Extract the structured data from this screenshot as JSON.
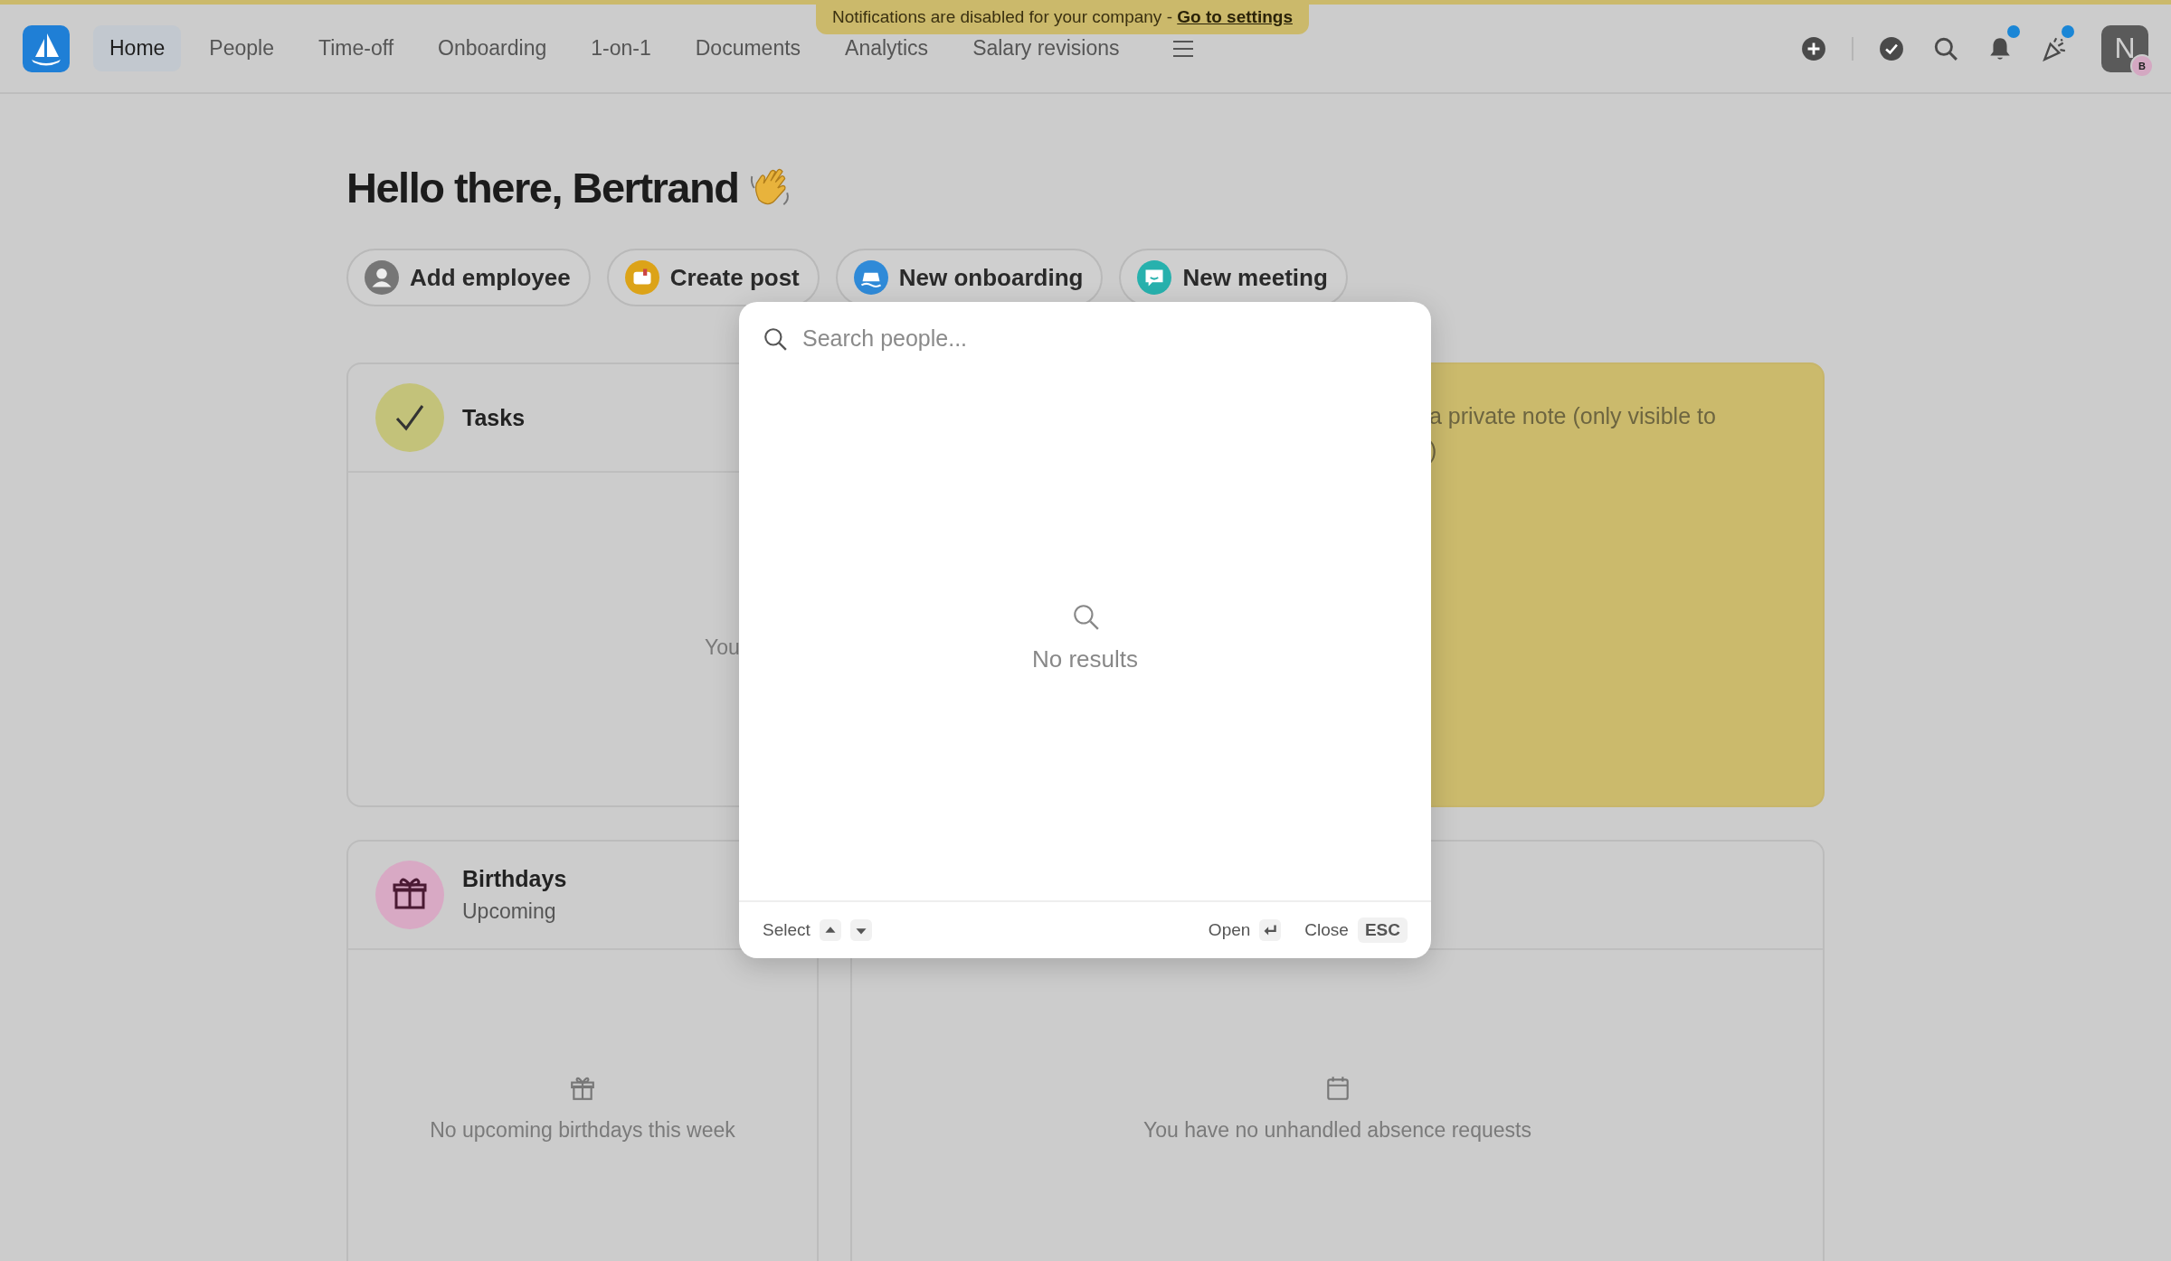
{
  "notification_banner": {
    "text": "Notifications are disabled for your company - ",
    "link": "Go to settings"
  },
  "nav": {
    "items": [
      {
        "label": "Home",
        "selected": true
      },
      {
        "label": "People",
        "selected": false
      },
      {
        "label": "Time-off",
        "selected": false
      },
      {
        "label": "Onboarding",
        "selected": false
      },
      {
        "label": "1-on-1",
        "selected": false
      },
      {
        "label": "Documents",
        "selected": false
      },
      {
        "label": "Analytics",
        "selected": false
      },
      {
        "label": "Salary revisions",
        "selected": false
      }
    ]
  },
  "toolbar": [
    {
      "kind": "add",
      "badge": false
    },
    {
      "kind": "tasks",
      "badge": false
    },
    {
      "kind": "search",
      "badge": false
    },
    {
      "kind": "notifications",
      "badge": true
    },
    {
      "kind": "celebrations",
      "badge": true
    }
  ],
  "avatar": {
    "initial": "N",
    "badge_initial": "B"
  },
  "greeting": "Hello there, Bertrand",
  "quick_actions": [
    {
      "label": "Add employee",
      "kind": "employee"
    },
    {
      "label": "Create post",
      "kind": "post"
    },
    {
      "label": "New onboarding",
      "kind": "onboarding"
    },
    {
      "label": "New meeting",
      "kind": "meeting"
    }
  ],
  "tasks_card": {
    "title": "Tasks",
    "text": "You"
  },
  "note_card": {
    "lines": [
      "a private note (only visible to",
      ")"
    ]
  },
  "birthdays_card": {
    "title": "Birthdays",
    "subtitle": "Upcoming",
    "empty": "No upcoming birthdays this week"
  },
  "absence_card": {
    "empty": "You have no unhandled absence requests"
  },
  "search_modal": {
    "placeholder": "Search people...",
    "empty": "No results",
    "select": "Select",
    "open": "Open",
    "close": "Close",
    "esc_key": "ESC"
  }
}
